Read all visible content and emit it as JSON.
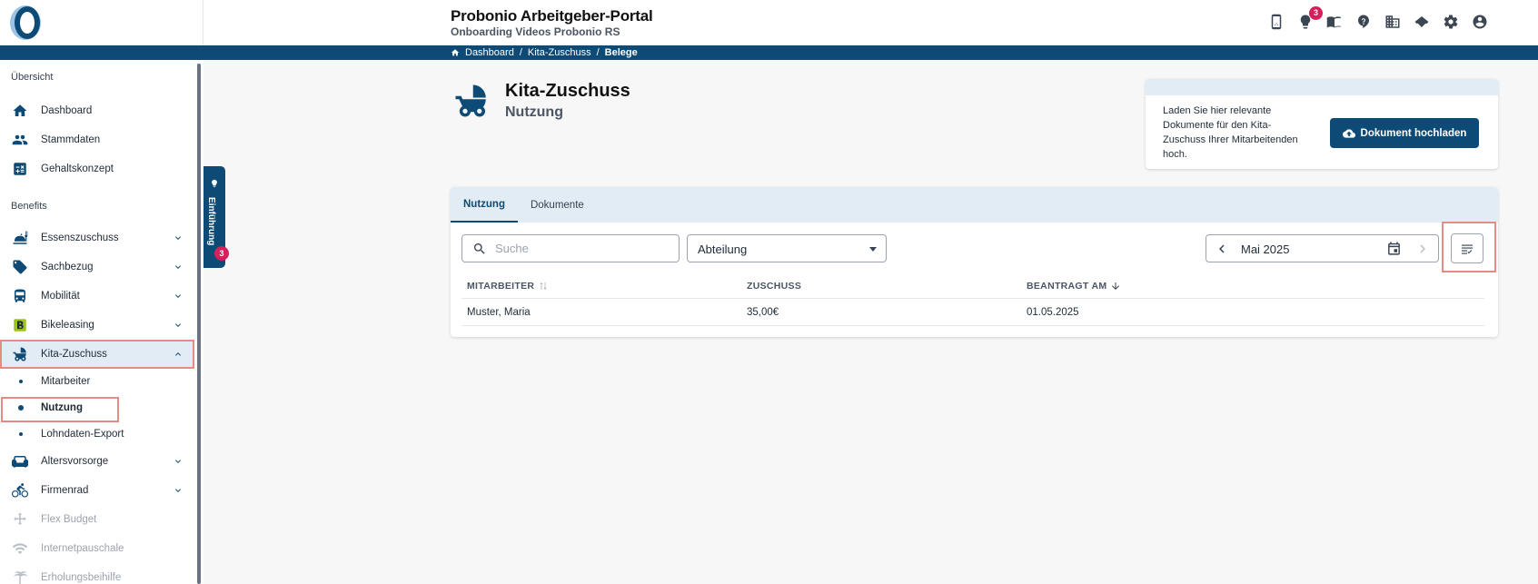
{
  "header": {
    "portal_title": "Probonio Arbeitgeber-Portal",
    "portal_subtitle": "Onboarding Videos Probonio RS",
    "notification_count": "3",
    "icons": [
      "phone-icon",
      "lightbulb-icon",
      "book-icon",
      "help-icon",
      "company-icon",
      "handshake-icon",
      "gear-icon",
      "account-icon"
    ]
  },
  "breadcrumb": {
    "items": [
      "Dashboard",
      "Kita-Zuschuss",
      "Belege"
    ],
    "separator": "/"
  },
  "sidebar": {
    "section_overview": "Übersicht",
    "section_benefits": "Benefits",
    "overview_items": [
      {
        "label": "Dashboard",
        "icon": "home-icon"
      },
      {
        "label": "Stammdaten",
        "icon": "people-icon"
      },
      {
        "label": "Gehaltskonzept",
        "icon": "calculator-icon"
      }
    ],
    "benefit_items": [
      {
        "label": "Essenszuschuss",
        "icon": "meal-icon"
      },
      {
        "label": "Sachbezug",
        "icon": "tag-icon"
      },
      {
        "label": "Mobilität",
        "icon": "bus-icon"
      },
      {
        "label": "Bikeleasing",
        "icon": "bikeleasing-logo-icon"
      },
      {
        "label": "Kita-Zuschuss",
        "icon": "stroller-icon",
        "active": true
      }
    ],
    "kita_subitems": [
      {
        "label": "Mitarbeiter"
      },
      {
        "label": "Nutzung",
        "active": true
      },
      {
        "label": "Lohndaten-Export"
      }
    ],
    "more_items": [
      {
        "label": "Altersvorsorge",
        "icon": "sofa-icon"
      },
      {
        "label": "Firmenrad",
        "icon": "bicycle-icon"
      },
      {
        "label": "Flex Budget",
        "icon": "flex-icon",
        "disabled": true
      },
      {
        "label": "Internetpauschale",
        "icon": "wifi-icon",
        "disabled": true
      },
      {
        "label": "Erholungsbeihilfe",
        "icon": "palm-icon",
        "disabled": true
      }
    ]
  },
  "intro_tab": {
    "label": "Einführung",
    "badge": "3"
  },
  "page": {
    "title": "Kita-Zuschuss",
    "subtitle": "Nutzung"
  },
  "upload_card": {
    "text": "Laden Sie hier relevante Dokumente für den Kita-Zuschuss Ihrer Mitarbeitenden hoch.",
    "button_label": "Dokument hochladen"
  },
  "tabs": [
    {
      "label": "Nutzung",
      "active": true
    },
    {
      "label": "Dokumente",
      "active": false
    }
  ],
  "filters": {
    "search_placeholder": "Suche",
    "search_value": "",
    "department_value": "Abteilung",
    "month_value": "Mai 2025"
  },
  "table": {
    "columns": [
      "MITARBEITER",
      "ZUSCHUSS",
      "BEANTRAGT AM"
    ],
    "rows": [
      [
        "Muster, Maria",
        "35,00€",
        "01.05.2025"
      ]
    ]
  },
  "colors": {
    "primary": "#0d4a75",
    "accent_light": "#e1ecf5",
    "badge": "#d61f5b",
    "highlight": "#e88a84"
  }
}
